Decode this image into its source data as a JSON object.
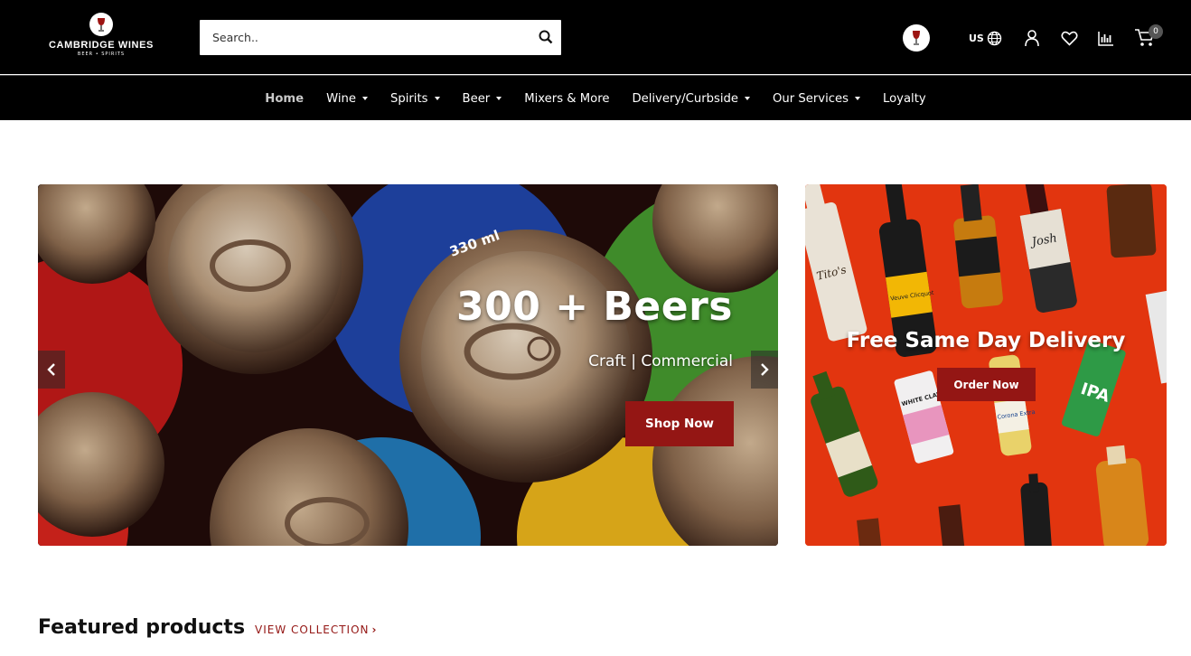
{
  "header": {
    "logo_brand": "CAMBRIDGE WINES",
    "logo_sub": "BEER • SPIRITS",
    "search_placeholder": "Search..",
    "locale": "us",
    "cart_count": "0"
  },
  "nav": {
    "items": [
      {
        "label": "Home",
        "active": true
      },
      {
        "label": "Wine",
        "dropdown": true
      },
      {
        "label": "Spirits",
        "dropdown": true
      },
      {
        "label": "Beer",
        "dropdown": true
      },
      {
        "label": "Mixers & More"
      },
      {
        "label": "Delivery/Curbside",
        "dropdown": true
      },
      {
        "label": "Our Services",
        "dropdown": true
      },
      {
        "label": "Loyalty"
      }
    ]
  },
  "hero": {
    "title": "300 + Beers",
    "subtitle": "Craft | Commercial",
    "button": "Shop Now",
    "can_text": "330 ml"
  },
  "promo": {
    "title": "Free Same Day Delivery",
    "button": "Order Now",
    "bottle_texts": [
      "Tito's",
      "Veuve Clicquot",
      "IPA",
      "WHITE CLAW",
      "Corona Extra",
      "Josh"
    ]
  },
  "featured": {
    "title": "Featured products",
    "link": "VIEW COLLECTION"
  },
  "colors": {
    "accent": "#941614",
    "header_bg": "#000000",
    "promo_bg": "#e2350f"
  }
}
